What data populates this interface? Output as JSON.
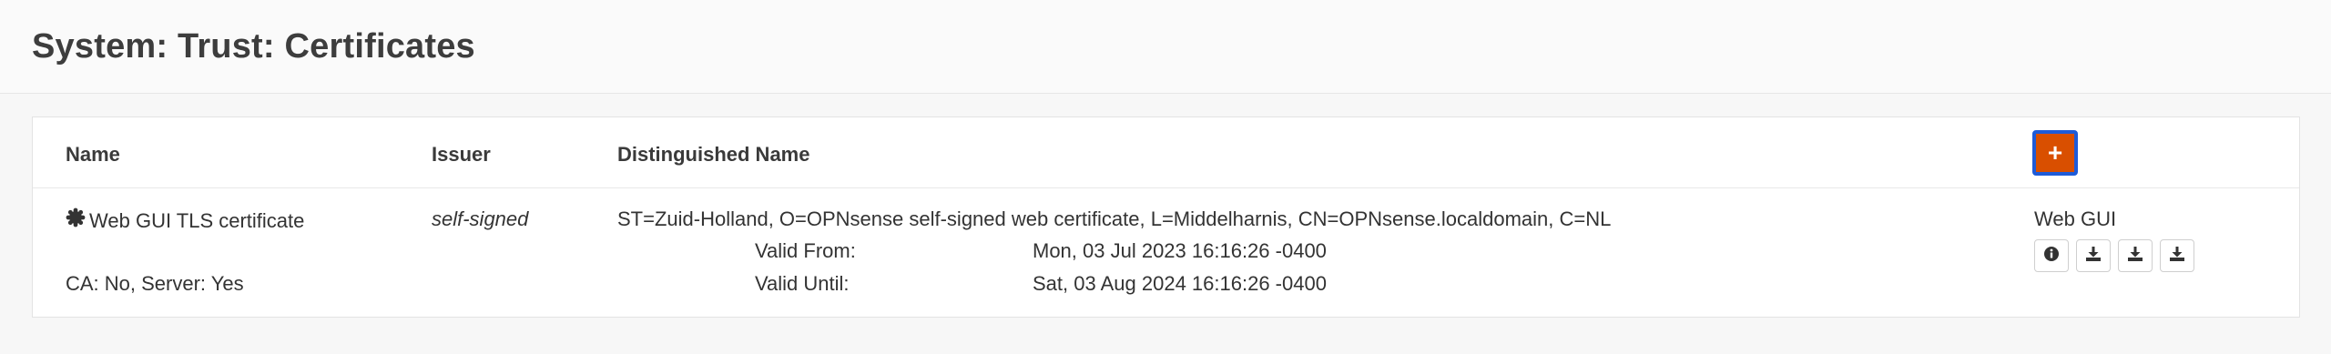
{
  "page": {
    "title": "System: Trust: Certificates"
  },
  "table": {
    "headers": {
      "name": "Name",
      "issuer": "Issuer",
      "dn": "Distinguished Name"
    },
    "add_button": {
      "label": "+",
      "icon": "plus-icon"
    },
    "rows": [
      {
        "name": "Web GUI TLS certificate",
        "name_icon": "certificate-icon",
        "ca_server": "CA: No, Server: Yes",
        "issuer": "self-signed",
        "dn": "ST=Zuid-Holland, O=OPNsense self-signed web certificate, L=Middelharnis, CN=OPNsense.localdomain, C=NL",
        "valid_from_label": "Valid From:",
        "valid_from": "Mon, 03 Jul 2023 16:16:26 -0400",
        "valid_until_label": "Valid Until:",
        "valid_until": "Sat, 03 Aug 2024 16:16:26 -0400",
        "in_use": "Web GUI",
        "actions": [
          "info-icon",
          "download-icon",
          "download-icon",
          "download-icon"
        ]
      }
    ]
  },
  "colors": {
    "accent": "#d94f00",
    "focus_outline": "#1e5bd8"
  }
}
